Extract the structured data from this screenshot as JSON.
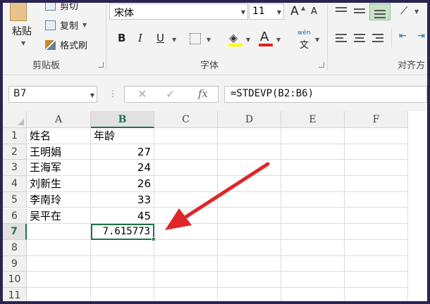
{
  "ribbon": {
    "clipboard": {
      "paste_label": "粘贴",
      "cut_label": "剪切",
      "copy_label": "复制",
      "format_painter_label": "格式刷",
      "group_label": "剪贴板"
    },
    "font": {
      "font_name": "宋体",
      "font_size": "11",
      "grow_label": "A",
      "shrink_label": "A",
      "bold_label": "B",
      "italic_label": "I",
      "underline_label": "U",
      "pinyin_label": "wén",
      "pinyin_char": "文",
      "group_label": "字体"
    },
    "alignment": {
      "group_label": "对齐方"
    }
  },
  "formula_bar": {
    "name_box": "B7",
    "cancel_glyph": "✕",
    "enter_glyph": "✓",
    "fx_label": "fx",
    "formula": "=STDEVP(B2:B6)"
  },
  "sheet": {
    "columns": [
      "A",
      "B",
      "C",
      "D",
      "E",
      "F"
    ],
    "selected_column": "B",
    "rows": [
      "1",
      "2",
      "3",
      "4",
      "5",
      "6",
      "7",
      "8",
      "9",
      "10",
      "11"
    ],
    "selected_row": "7",
    "cells": {
      "A1": "姓名",
      "B1": "年龄",
      "A2": "王明娟",
      "B2": "27",
      "A3": "王海军",
      "B3": "24",
      "A4": "刘新生",
      "B4": "26",
      "A5": "李南玲",
      "B5": "33",
      "A6": "吴平在",
      "B6": "45",
      "B7": "7.615773"
    },
    "active_cell": "B7"
  },
  "colors": {
    "accent": "#217346",
    "annotation_arrow": "#e0262b",
    "background": "#2a2452"
  }
}
